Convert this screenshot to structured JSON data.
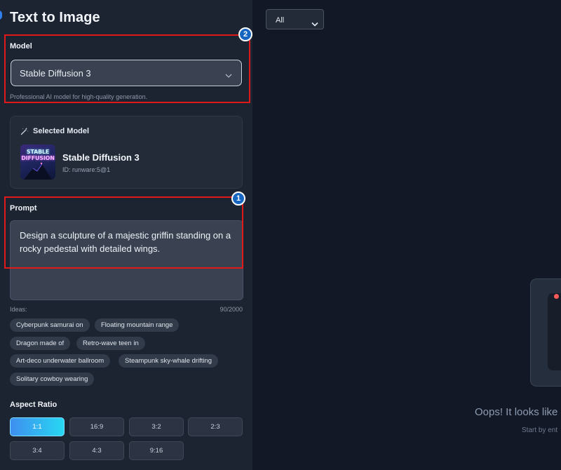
{
  "sidebar": {
    "title": "Text to Image",
    "model": {
      "label": "Model",
      "selected": "Stable Diffusion 3",
      "help": "Professional AI model for high-quality generation."
    },
    "selected_model_card": {
      "heading": "Selected Model",
      "thumbnail_text_line1": "STABLE",
      "thumbnail_text_line2": "DIFFUSION",
      "name": "Stable Diffusion 3",
      "id": "ID: runware:5@1"
    },
    "prompt": {
      "label": "Prompt",
      "value": "Design a sculpture of a majestic griffin standing on a rocky pedestal with detailed wings.",
      "ideas_label": "Ideas:",
      "char_count": "90/2000"
    },
    "ideas": [
      "Cyberpunk samurai on",
      "Floating mountain range",
      "Dragon made of",
      "Retro-wave teen in",
      "Art-deco underwater ballroom",
      "Steampunk sky-whale drifting",
      "Solitary cowboy wearing"
    ],
    "aspect_ratio": {
      "label": "Aspect Ratio",
      "options": [
        "1:1",
        "16:9",
        "3:2",
        "2:3",
        "3:4",
        "4:3",
        "9:16"
      ],
      "selected": "1:1"
    }
  },
  "annotations": {
    "badge_prompt": "1",
    "badge_model": "2",
    "highlight_color": "#e01a1a",
    "badge_color": "#1665c1"
  },
  "main": {
    "filter": {
      "selected": "All"
    },
    "empty_state": {
      "title": "Oops! It looks like",
      "subtitle": "Start by ent"
    }
  },
  "colors": {
    "accent_gradient_start": "#3f8ff0",
    "accent_gradient_end": "#27d7f2",
    "sidebar_bg": "#1c2432",
    "main_bg": "#121826"
  },
  "icons": {
    "model_dropdown": "chevron-down-icon",
    "selected_model": "magic-wand-icon",
    "filter_dropdown": "chevron-down-icon"
  }
}
